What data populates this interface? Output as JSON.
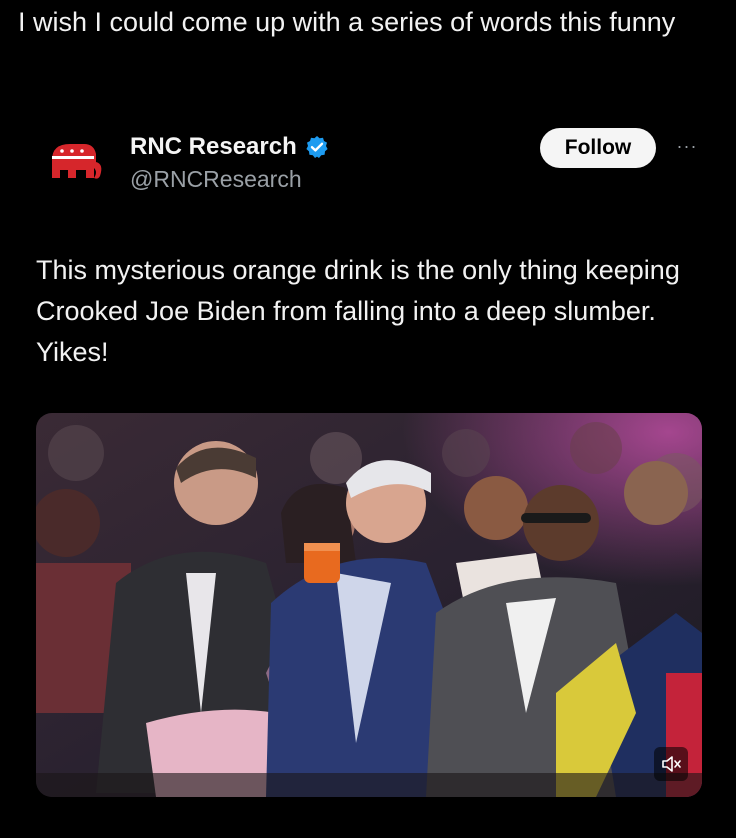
{
  "caption": "I wish I could come up with a series of words this funny",
  "tweet": {
    "display_name": "RNC Research",
    "handle": "@RNCResearch",
    "follow_label": "Follow",
    "more_label": "···",
    "text": "This mysterious orange drink is the only thing keeping Crooked Joe Biden from falling into a deep slumber. Yikes!",
    "media": {
      "type": "video",
      "muted": true
    }
  },
  "colors": {
    "background": "#000000",
    "logo_red": "#d6262b",
    "verified_blue": "#1d9bf0",
    "follow_bg": "#f5f5f5",
    "secondary_text": "#9aa0a6"
  },
  "icons": [
    "rnc-elephant-logo-icon",
    "verified-badge-icon",
    "more-options-icon",
    "mute-icon"
  ]
}
